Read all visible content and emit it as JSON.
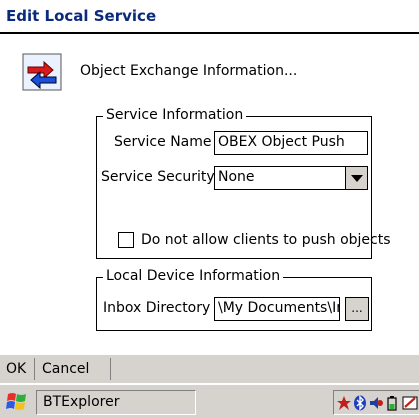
{
  "window": {
    "title": "Edit Local Service"
  },
  "header": {
    "text": "Object Exchange Information...",
    "icon": "object-exchange-icon"
  },
  "service_info": {
    "legend": "Service Information",
    "name_label": "Service Name :",
    "name_value": "OBEX Object Push",
    "security_label": "Service Security :",
    "security_value": "None",
    "checkbox_label": "Do not allow clients to push objects",
    "checkbox_checked": false
  },
  "local_device": {
    "legend": "Local Device Information",
    "inbox_label": "Inbox Directory :",
    "inbox_value": "\\My Documents\\In",
    "browse_label": "..."
  },
  "menubar": {
    "ok": "OK",
    "cancel": "Cancel"
  },
  "taskbar": {
    "start_icon": "windows-start-icon",
    "task_label": "BTExplorer",
    "tray_icons": [
      "network-icon",
      "bluetooth-icon",
      "volume-icon",
      "battery-icon",
      "input-panel-icon",
      "desktop-icon"
    ]
  }
}
